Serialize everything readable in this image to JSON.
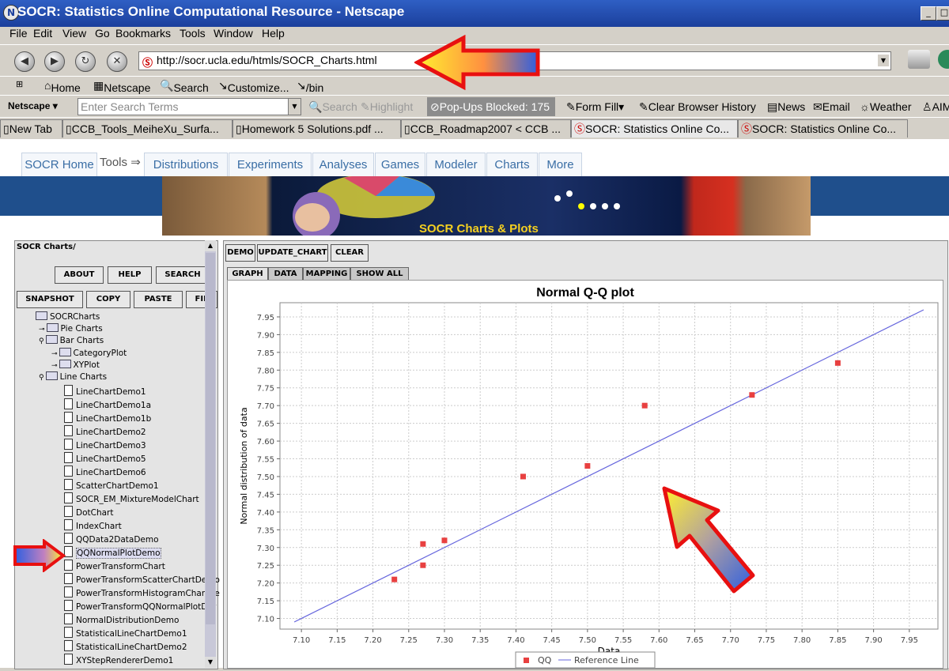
{
  "window": {
    "title": "SOCR: Statistics Online Computational Resource - Netscape",
    "icon": "netscape-icon"
  },
  "menu": [
    "File",
    "Edit",
    "View",
    "Go",
    "Bookmarks",
    "Tools",
    "Window",
    "Help"
  ],
  "nav": {
    "url": "http://socr.ucla.edu/htmls/SOCR_Charts.html"
  },
  "personal_toolbar": {
    "home": "Home",
    "netscape": "Netscape",
    "search": "Search",
    "customize": "Customize...",
    "bin": "/bin"
  },
  "search_toolbar": {
    "brand": "Netscape",
    "placeholder": "Enter Search Terms",
    "search": "Search",
    "highlight": "Highlight",
    "popups": "Pop-Ups Blocked: 175",
    "formfill": "Form Fill",
    "clear_history": "Clear Browser History",
    "news": "News",
    "email": "Email",
    "weather": "Weather",
    "aim": "AIM"
  },
  "browser_tabs": [
    "New Tab",
    "CCB_Tools_MeiheXu_Surfa...",
    "Homework 5 Solutions.pdf ...",
    "CCB_Roadmap2007 < CCB ...",
    "SOCR: Statistics Online Co...",
    "SOCR: Statistics Online Co..."
  ],
  "socr_nav": {
    "home": "SOCR Home",
    "tools": "Tools",
    "tabs": [
      "Distributions",
      "Experiments",
      "Analyses",
      "Games",
      "Modeler",
      "Charts",
      "More"
    ]
  },
  "banner": {
    "text": "SOCR Charts & Plots"
  },
  "left_panel": {
    "title": "SOCR Charts/",
    "buttons_row1": [
      "ABOUT",
      "HELP",
      "SEARCH"
    ],
    "buttons_row2": [
      "SNAPSHOT",
      "COPY",
      "PASTE",
      "FIL"
    ],
    "root": "SOCRCharts",
    "folders": {
      "pie": "Pie Charts",
      "bar": "Bar Charts",
      "category": "CategoryPlot",
      "xy": "XYPlot",
      "line": "Line Charts"
    },
    "items": [
      "LineChartDemo1",
      "LineChartDemo1a",
      "LineChartDemo1b",
      "LineChartDemo2",
      "LineChartDemo3",
      "LineChartDemo5",
      "LineChartDemo6",
      "ScatterChartDemo1",
      "SOCR_EM_MixtureModelChart",
      "DotChart",
      "IndexChart",
      "QQData2DataDemo",
      "QQNormalPlotDemo",
      "PowerTransformChart",
      "PowerTransformScatterChartDemo",
      "PowerTransformHistogramChartDe",
      "PowerTransformQQNormalPlotDer",
      "NormalDistributionDemo",
      "StatisticalLineChartDemo1",
      "StatisticalLineChartDemo2",
      "XYStepRendererDemo1"
    ],
    "selected_item": "QQNormalPlotDemo"
  },
  "right_panel": {
    "buttons": [
      "DEMO",
      "UPDATE_CHART",
      "CLEAR"
    ],
    "tabs": [
      "GRAPH",
      "DATA",
      "MAPPING",
      "SHOW ALL"
    ],
    "active_tab": "GRAPH"
  },
  "chart_data": {
    "type": "scatter",
    "title": "Normal Q-Q plot",
    "xlabel": "Data",
    "ylabel": "Normal distribution of data",
    "xlim": [
      7.07,
      7.99
    ],
    "ylim": [
      7.07,
      7.99
    ],
    "xticks": [
      "7.10",
      "7.15",
      "7.20",
      "7.25",
      "7.30",
      "7.35",
      "7.40",
      "7.45",
      "7.50",
      "7.55",
      "7.60",
      "7.65",
      "7.70",
      "7.75",
      "7.80",
      "7.85",
      "7.90",
      "7.95"
    ],
    "yticks": [
      "7.10",
      "7.15",
      "7.20",
      "7.25",
      "7.30",
      "7.35",
      "7.40",
      "7.45",
      "7.50",
      "7.55",
      "7.60",
      "7.65",
      "7.70",
      "7.75",
      "7.80",
      "7.85",
      "7.90",
      "7.95"
    ],
    "grid": true,
    "series": [
      {
        "name": "QQ",
        "color": "#e84040",
        "marker": "square",
        "x": [
          7.23,
          7.27,
          7.27,
          7.3,
          7.41,
          7.5,
          7.58,
          7.73,
          7.85
        ],
        "y": [
          7.21,
          7.25,
          7.31,
          7.32,
          7.5,
          7.53,
          7.7,
          7.73,
          7.82
        ]
      },
      {
        "name": "Reference Line",
        "color": "#6666dd",
        "kind": "line",
        "x": [
          7.09,
          7.97
        ],
        "y": [
          7.09,
          7.97
        ]
      }
    ]
  },
  "colors": {
    "title_bar": "#1b3f9c",
    "socr_tab_text": "#3a6ea5",
    "point": "#e84040",
    "ref_line": "#6666dd",
    "annotation_arrow": "#e81010"
  }
}
